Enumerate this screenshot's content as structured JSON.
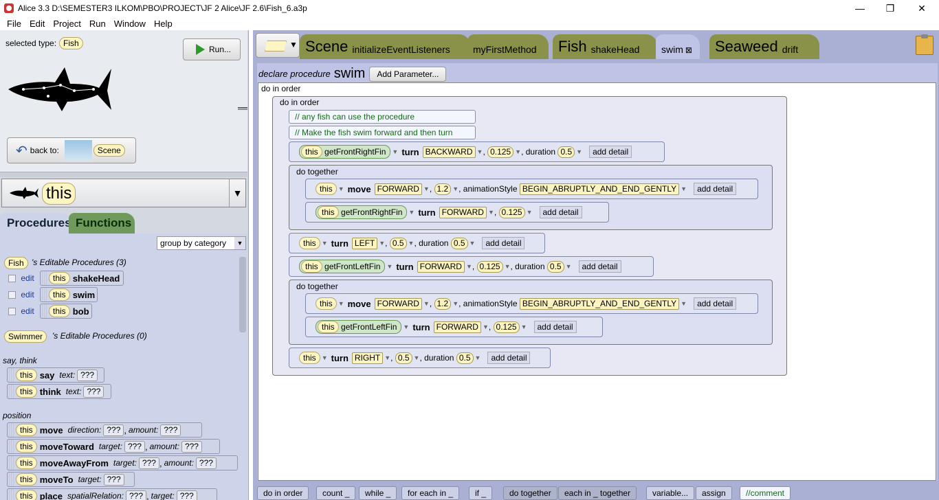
{
  "window": {
    "title": "Alice  3.3 D:\\SEMESTER3 ILKOM\\PBO\\PROJECT\\JF 2 Alice\\JF 2.6\\Fish_6.a3p",
    "minimize": "—",
    "maximize": "❐",
    "close": "✕"
  },
  "menu": [
    "File",
    "Edit",
    "Project",
    "Run",
    "Window",
    "Help"
  ],
  "scene_panel": {
    "selected_type_label": "selected type:",
    "selected_type": "Fish",
    "run_label": "Run...",
    "back_to_label": "back to:",
    "back_to_target": "Scene"
  },
  "instance_combo": {
    "value": "this"
  },
  "palette_tabs": [
    "Procedures",
    "Functions"
  ],
  "group_by": "group by category",
  "fish_procs_header": {
    "type": "Fish",
    "suffix": "'s Editable Procedures (3)"
  },
  "fish_procs": [
    {
      "edit": "edit",
      "this": "this",
      "name": "shakeHead"
    },
    {
      "edit": "edit",
      "this": "this",
      "name": "swim"
    },
    {
      "edit": "edit",
      "this": "this",
      "name": "bob"
    }
  ],
  "swimmer_procs_header": {
    "type": "Swimmer",
    "suffix": "'s Editable Procedures (0)"
  },
  "category_say": "say, think",
  "category_position": "position",
  "tiles": {
    "say": {
      "this": "this",
      "name": "say",
      "arg": "text:",
      "val": "???"
    },
    "think": {
      "this": "this",
      "name": "think",
      "arg": "text:",
      "val": "???"
    },
    "move": {
      "this": "this",
      "name": "move",
      "arg1": "direction:",
      "val1": "???",
      "arg2": "amount:",
      "val2": "???"
    },
    "moveToward": {
      "this": "this",
      "name": "moveToward",
      "arg1": "target:",
      "val1": "???",
      "arg2": "amount:",
      "val2": "???"
    },
    "moveAwayFrom": {
      "this": "this",
      "name": "moveAwayFrom",
      "arg1": "target:",
      "val1": "???",
      "arg2": "amount:",
      "val2": "???"
    },
    "moveTo": {
      "this": "this",
      "name": "moveTo",
      "arg1": "target:",
      "val1": "???"
    },
    "place": {
      "this": "this",
      "name": "place",
      "arg1": "spatialRelation:",
      "val1": "???",
      "arg2": "target:",
      "val2": "???"
    }
  },
  "editor_tabs": {
    "scene_big": "Scene",
    "scene_methods": [
      "initializeEventListeners",
      "myFirstMethod"
    ],
    "fish_big": "Fish",
    "fish_methods": [
      "shakeHead",
      "swim"
    ],
    "seaweed_big": "Seaweed",
    "seaweed_methods": [
      "drift"
    ],
    "close_mark": "⊠"
  },
  "declare": {
    "label": "declare procedure",
    "name": "swim",
    "add_param": "Add Parameter..."
  },
  "code": {
    "outer_do_in_order": "do in order",
    "inner_do_in_order": "do in order",
    "comment1": "// any fish can use the procedure",
    "comment2": "// Make the fish swim forward and then turn",
    "s1": {
      "this": "this",
      "fn": "getFrontRightFin",
      "verb": "turn",
      "dir": "BACKWARD",
      "amt": "0.125",
      "dur_label": ", duration",
      "dur": "0.5",
      "add": "add detail"
    },
    "dt1_label": "do together",
    "dt1_a": {
      "this": "this",
      "verb": "move",
      "dir": "FORWARD",
      "amt": "1.2",
      "style_label": ", animationStyle",
      "style": "BEGIN_ABRUPTLY_AND_END_GENTLY",
      "add": "add detail"
    },
    "dt1_b": {
      "this": "this",
      "fn": "getFrontRightFin",
      "verb": "turn",
      "dir": "FORWARD",
      "amt": "0.125",
      "add": "add detail"
    },
    "s3": {
      "this": "this",
      "verb": "turn",
      "dir": "LEFT",
      "amt": "0.5",
      "dur_label": ", duration",
      "dur": "0.5",
      "add": "add detail"
    },
    "s4": {
      "this": "this",
      "fn": "getFrontLeftFin",
      "verb": "turn",
      "dir": "FORWARD",
      "amt": "0.125",
      "dur_label": ", duration",
      "dur": "0.5",
      "add": "add detail"
    },
    "dt2_label": "do together",
    "dt2_a": {
      "this": "this",
      "verb": "move",
      "dir": "FORWARD",
      "amt": "1.2",
      "style_label": ", animationStyle",
      "style": "BEGIN_ABRUPTLY_AND_END_GENTLY",
      "add": "add detail"
    },
    "dt2_b": {
      "this": "this",
      "fn": "getFrontLeftFin",
      "verb": "turn",
      "dir": "FORWARD",
      "amt": "0.125",
      "add": "add detail"
    },
    "s6": {
      "this": "this",
      "verb": "turn",
      "dir": "RIGHT",
      "amt": "0.5",
      "dur_label": ", duration",
      "dur": "0.5",
      "add": "add detail"
    }
  },
  "bottom_bar": [
    "do in order",
    "count _",
    "while _",
    "for each in _",
    "if _",
    "do together",
    "each in _ together",
    "variable...",
    "assign",
    "//comment"
  ]
}
